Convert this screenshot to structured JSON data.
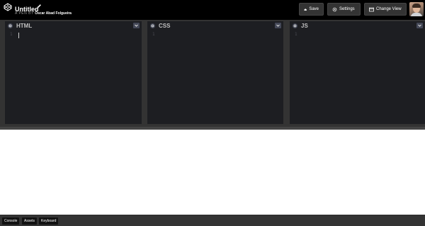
{
  "header": {
    "title": "Untitled",
    "pen_label": "A PEN BY",
    "author": "Oscar Abad Folgueira",
    "buttons": {
      "save": "Save",
      "settings": "Settings",
      "change_view": "Change View"
    }
  },
  "editors": [
    {
      "title": "HTML",
      "line_numbers": "1"
    },
    {
      "title": "CSS",
      "line_numbers": "1"
    },
    {
      "title": "JS",
      "line_numbers": "1"
    }
  ],
  "footer": {
    "console": "Console",
    "assets": "Assets",
    "keyboard": "Keyboard"
  },
  "colors": {
    "header_bg": "#000000",
    "editor_bg": "#1d1e22",
    "chrome_bg": "#333333",
    "button_bg": "#333333"
  },
  "icons": {
    "logo": "codepen-logo-icon",
    "edit": "pencil-icon",
    "save": "cloud-icon",
    "settings": "gear-icon",
    "change_view": "layout-icon",
    "panel_settings": "gear-icon",
    "panel_menu": "chevron-down-icon"
  }
}
